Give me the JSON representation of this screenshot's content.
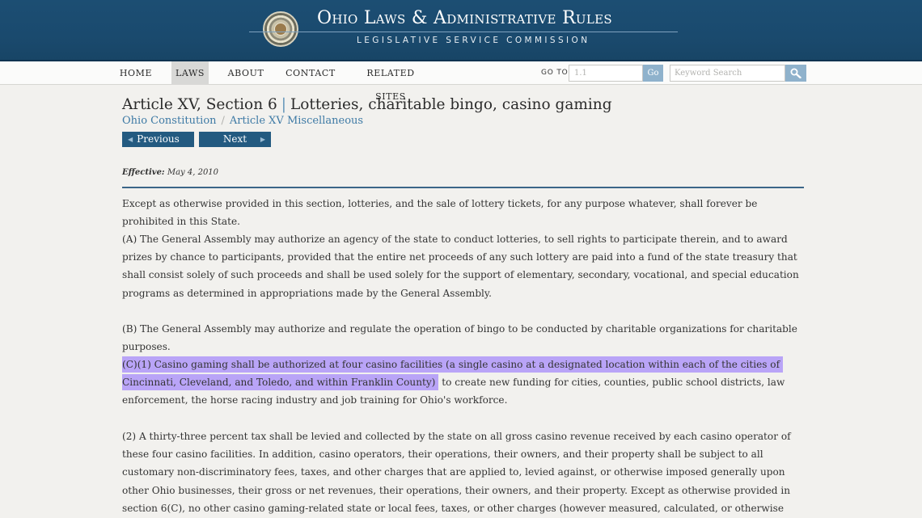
{
  "header": {
    "title": "Ohio Laws & Administrative Rules",
    "subtitle": "LEGISLATIVE SERVICE COMMISSION"
  },
  "nav": {
    "items": [
      "HOME",
      "LAWS",
      "ABOUT",
      "CONTACT",
      "RELATED SITES"
    ],
    "active": "LAWS",
    "goto_label": "GO TO",
    "goto_placeholder": "1.1",
    "go_label": "Go",
    "keyword_placeholder": "Keyword Search"
  },
  "page": {
    "title_section": "Article XV, Section 6",
    "title_separator": "|",
    "title_name": "Lotteries, charitable bingo, casino gaming",
    "breadcrumb": [
      "Ohio Constitution",
      "Article XV Miscellaneous"
    ],
    "breadcrumb_separator": "/",
    "prev_label": "Previous",
    "next_label": "Next",
    "effective_label": "Effective:",
    "effective_date": "May 4, 2010"
  },
  "paragraphs": {
    "intro": "Except as otherwise provided in this section, lotteries, and the sale of lottery tickets, for any purpose whatever, shall forever be prohibited in this State.",
    "a": "(A) The General Assembly may authorize an agency of the state to conduct lotteries, to sell rights to participate therein, and to award prizes by chance to participants, provided that the entire net proceeds of any such lottery are paid into a fund of the state treasury that shall consist solely of such proceeds and shall be used solely for the support of elementary, secondary, vocational, and special education programs as determined in appropriations made by the General Assembly.",
    "b": "(B) The General Assembly may authorize and regulate the operation of bingo to be conducted by charitable organizations for charitable purposes.",
    "c1_highlight": "(C)(1) Casino gaming shall be authorized at four casino facilities (a single casino at a designated location within each of the cities of Cincinnati, Cleveland, and Toledo, and within Franklin County)",
    "c1_rest": " to create new funding for cities, counties, public school districts, law enforcement, the horse racing industry and job training for Ohio's workforce.",
    "c2": "(2) A thirty-three percent tax shall be levied and collected by the state on all gross casino revenue received by each casino operator of these four casino facilities. In addition, casino operators, their operations, their owners, and their property shall be subject to all customary non-discriminatory fees, taxes, and other charges that are applied to, levied against, or otherwise imposed generally upon other Ohio businesses, their gross or net revenues, their operations, their owners, and their property. Except as otherwise provided in section 6(C), no other casino gaming-related state or local fees, taxes, or other charges (however measured, calculated, or otherwise derived) may be, directly or indirectly, applied to, levied against, or otherwise imposed upon gross casino revenue, casino"
  },
  "colors": {
    "header_bg": "#1a4a6e",
    "link": "#3e7aa5",
    "button_bg": "#235a80",
    "highlight": "#b9a4f7"
  }
}
